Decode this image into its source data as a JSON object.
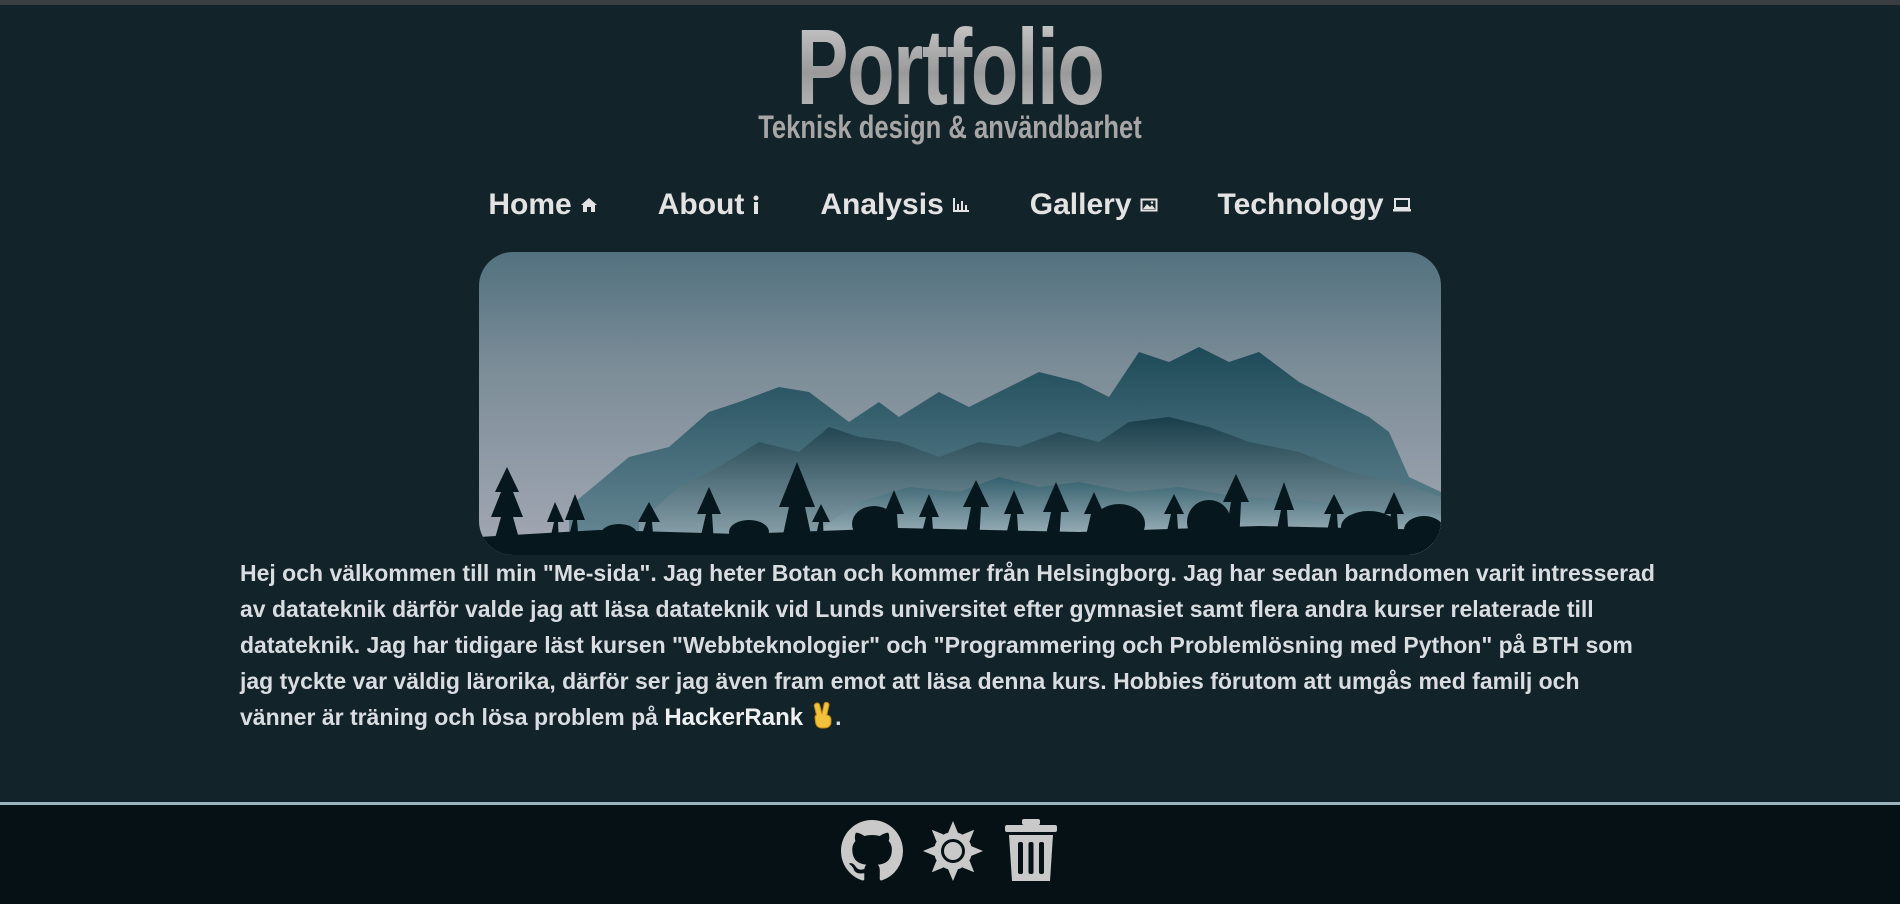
{
  "header": {
    "title": "Portfolio",
    "subtitle": "Teknisk design & användbarhet"
  },
  "nav": {
    "items": [
      {
        "label": "Home",
        "icon": "home-icon"
      },
      {
        "label": "About",
        "icon": "info-icon"
      },
      {
        "label": "Analysis",
        "icon": "bar-chart-icon"
      },
      {
        "label": "Gallery",
        "icon": "image-icon"
      },
      {
        "label": "Technology",
        "icon": "laptop-icon"
      }
    ]
  },
  "hero": {
    "image": "mountain-forest-illustration"
  },
  "intro": {
    "text": "Hej och välkommen till min \"Me-sida\". Jag heter Botan och kommer från Helsingborg. Jag har sedan barndomen varit intresserad av datateknik därför valde jag att läsa datateknik vid Lunds universitet efter gymnasiet samt flera andra kurser relaterade till datateknik. Jag har tidigare läst kursen \"Webbteknologier\" och \"Programmering och Problemlösning med Python\" på BTH som jag tyckte var väldig lärorika, därför ser jag även fram emot att läsa denna kurs. Hobbies förutom att umgås med familj och vänner är träning och lösa problem på",
    "link_label": "HackerRank",
    "emoji": "victory-hand-emoji",
    "end": "."
  },
  "footer": {
    "icons": [
      "github-icon",
      "theme-toggle-sun-icon",
      "trash-icon"
    ]
  },
  "colors": {
    "background": "#13232a",
    "footer": "#051114",
    "text": "#d9dde0"
  }
}
